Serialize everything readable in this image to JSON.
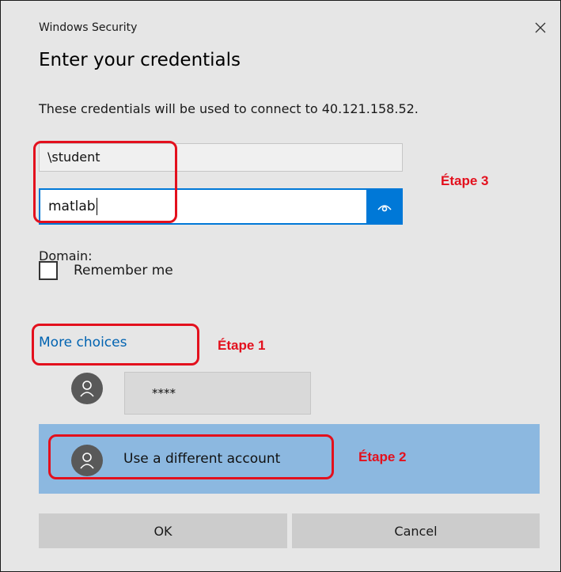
{
  "window": {
    "title": "Windows Security",
    "close_icon": "close-icon"
  },
  "dialog": {
    "heading": "Enter your credentials",
    "description": "These credentials will be used to connect to 40.121.158.52."
  },
  "fields": {
    "username_value": "\\student",
    "password_value": "matlab",
    "reveal_icon": "eye-icon"
  },
  "domain_label": "Domain:",
  "remember": {
    "label": "Remember me",
    "checked": false
  },
  "more_choices": {
    "label": "More choices"
  },
  "accounts": [
    {
      "label": "****",
      "icon": "user-icon"
    },
    {
      "label": "Use a different account",
      "icon": "user-icon",
      "selected": true
    }
  ],
  "buttons": {
    "ok": "OK",
    "cancel": "Cancel"
  },
  "annotations": {
    "step1": "Étape 1",
    "step2": "Étape 2",
    "step3": "Étape 3",
    "color": "#e3101d"
  },
  "colors": {
    "accent": "#0078d7",
    "selected_row": "#8cb8e0",
    "link": "#0063b1"
  }
}
